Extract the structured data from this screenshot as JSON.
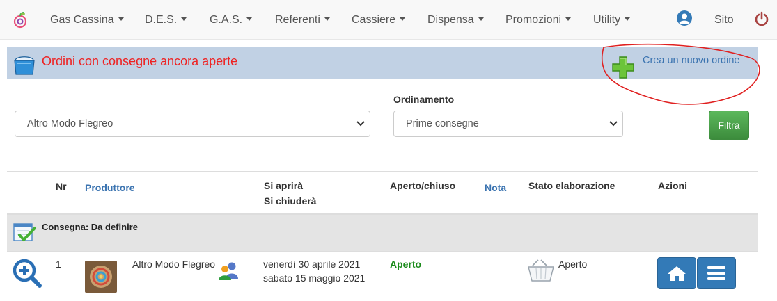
{
  "navbar": {
    "items": [
      {
        "label": "Gas Cassina"
      },
      {
        "label": "D.E.S."
      },
      {
        "label": "G.A.S."
      },
      {
        "label": "Referenti"
      },
      {
        "label": "Cassiere"
      },
      {
        "label": "Dispensa"
      },
      {
        "label": "Promozioni"
      },
      {
        "label": "Utility"
      }
    ],
    "site_label": "Sito",
    "icons": {
      "logo": "app-logo",
      "user": "user-circle-icon",
      "power": "power-icon"
    }
  },
  "title_bar": {
    "title": "Ordini con consegne ancora aperte",
    "new_order_label": "Crea un nuovo ordine",
    "title_color": "#ee2222",
    "background": "#c1d1e4"
  },
  "filters": {
    "producer_select": {
      "value": "Altro Modo Flegreo"
    },
    "sort_label": "Ordinamento",
    "sort_select": {
      "value": "Prime consegne"
    },
    "filter_button": "Filtra"
  },
  "table": {
    "headers": {
      "nr": "Nr",
      "producer": "Produttore",
      "opens": "Si aprirà",
      "closes": "Si chiuderà",
      "open_closed": "Aperto/chiuso",
      "note": "Nota",
      "processing_state": "Stato elaborazione",
      "actions": "Azioni"
    },
    "group": {
      "label": "Consegna: Da definire"
    },
    "rows": [
      {
        "nr": "1",
        "producer": "Altro Modo Flegreo",
        "open_date": "venerdì 30 aprile 2021",
        "close_date": "sabato 15 maggio 2021",
        "status": "Aperto",
        "status_color": "#1a8a1a",
        "processing_state": "Aperto"
      }
    ]
  },
  "colors": {
    "primary": "#337ab7",
    "success": "#4cae4c",
    "link": "#3a73b0"
  }
}
